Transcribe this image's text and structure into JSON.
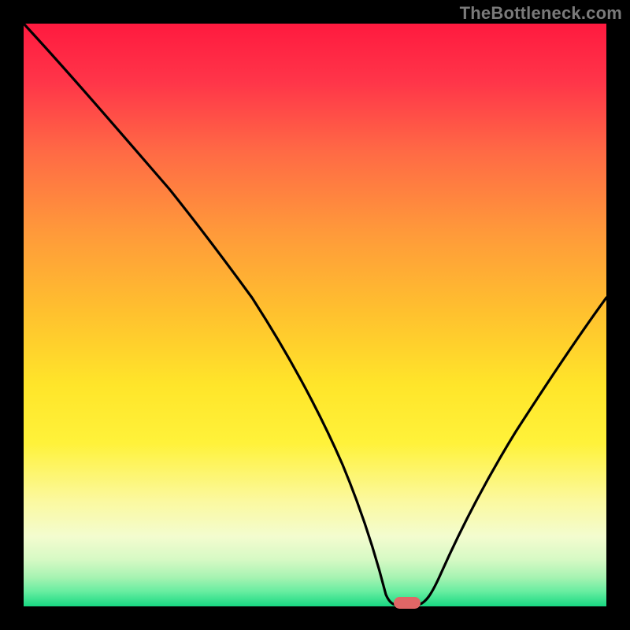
{
  "watermark": "TheBottleneck.com",
  "chart_data": {
    "type": "line",
    "title": "",
    "xlabel": "",
    "ylabel": "",
    "xlim": [
      0,
      100
    ],
    "ylim": [
      0,
      100
    ],
    "x": [
      0,
      5,
      10,
      15,
      20,
      25,
      30,
      35,
      40,
      45,
      50,
      55,
      58,
      62,
      66,
      70,
      75,
      80,
      85,
      90,
      95,
      100
    ],
    "values": [
      100,
      92,
      84,
      76,
      68,
      62,
      57,
      50,
      42,
      33,
      23,
      12,
      3,
      0,
      0,
      5,
      15,
      26,
      36,
      45,
      53,
      60
    ],
    "minimum_x": 64,
    "minimum_marker": {
      "x": 64,
      "y": 0
    },
    "background_gradient": [
      "#ff1744",
      "#ff5252",
      "#ff9800",
      "#ffc107",
      "#ffeb3b",
      "#fff176",
      "#eafdd7",
      "#b7f7c1",
      "#2fe08a"
    ],
    "note": "Percentage values estimated from plot geometry; y=0 at bottom (green), y=100 at top (red)."
  }
}
